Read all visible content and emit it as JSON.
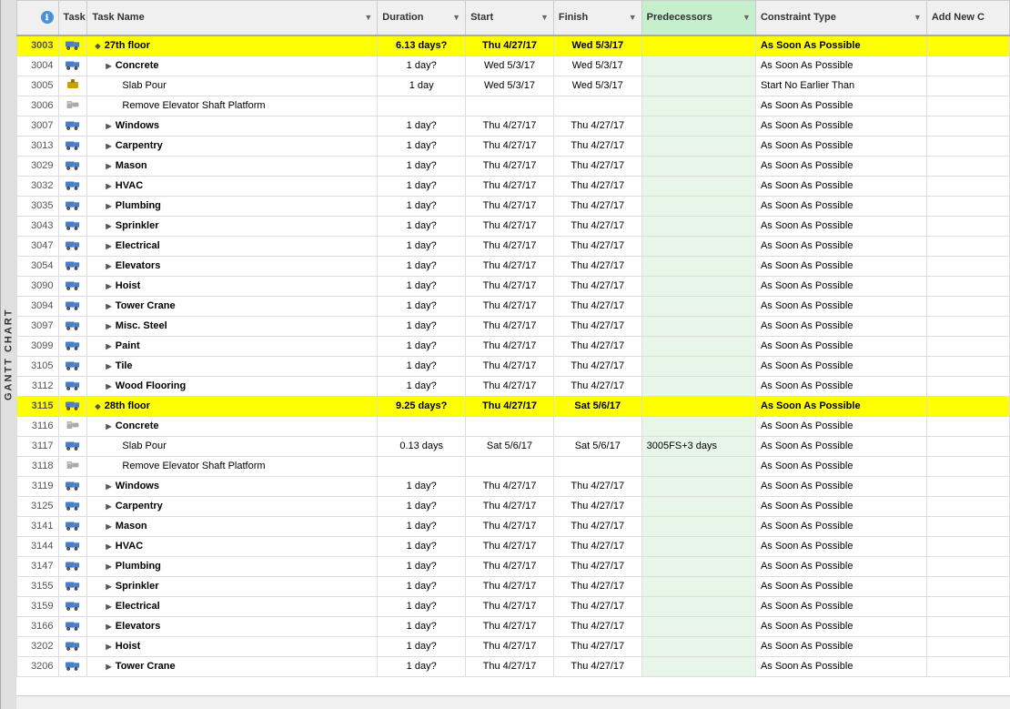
{
  "gantt_label": "GANTT CHART",
  "columns": {
    "row_num": "",
    "info": "ℹ",
    "task_mode": "Task Mode",
    "task_name": "Task Name",
    "duration": "Duration",
    "start": "Start",
    "finish": "Finish",
    "predecessors": "Predecessors",
    "constraint_type": "Constraint Type",
    "add_new": "Add New C"
  },
  "rows": [
    {
      "id": "3003",
      "mode_icon": "🚛",
      "name": "27th floor",
      "indent": 1,
      "bold": true,
      "diamond": true,
      "duration": "6.13 days?",
      "start": "Thu 4/27/17",
      "finish": "Wed 5/3/17",
      "predecessors": "",
      "constraint": "As Soon As Possible",
      "summary": true
    },
    {
      "id": "3004",
      "mode_icon": "🚛",
      "name": "Concrete",
      "indent": 2,
      "bold": true,
      "diamond": false,
      "duration": "1 day?",
      "start": "Wed 5/3/17",
      "finish": "Wed 5/3/17",
      "predecessors": "",
      "constraint": "As Soon As Possible",
      "summary": false
    },
    {
      "id": "3005",
      "mode_icon": "📌",
      "name": "Slab Pour",
      "indent": 3,
      "bold": false,
      "diamond": false,
      "duration": "1 day",
      "start": "Wed 5/3/17",
      "finish": "Wed 5/3/17",
      "predecessors": "",
      "constraint": "Start No Earlier Than",
      "summary": false
    },
    {
      "id": "3006",
      "mode_icon": "🔧",
      "name": "Remove Elevator Shaft Platform",
      "indent": 3,
      "bold": false,
      "diamond": false,
      "duration": "",
      "start": "",
      "finish": "",
      "predecessors": "",
      "constraint": "As Soon As Possible",
      "summary": false
    },
    {
      "id": "3007",
      "mode_icon": "🚛",
      "name": "Windows",
      "indent": 2,
      "bold": true,
      "diamond": true,
      "duration": "1 day?",
      "start": "Thu 4/27/17",
      "finish": "Thu 4/27/17",
      "predecessors": "",
      "constraint": "As Soon As Possible",
      "summary": false
    },
    {
      "id": "3013",
      "mode_icon": "🚛",
      "name": "Carpentry",
      "indent": 2,
      "bold": true,
      "diamond": true,
      "duration": "1 day?",
      "start": "Thu 4/27/17",
      "finish": "Thu 4/27/17",
      "predecessors": "",
      "constraint": "As Soon As Possible",
      "summary": false
    },
    {
      "id": "3029",
      "mode_icon": "🚛",
      "name": "Mason",
      "indent": 2,
      "bold": true,
      "diamond": true,
      "duration": "1 day?",
      "start": "Thu 4/27/17",
      "finish": "Thu 4/27/17",
      "predecessors": "",
      "constraint": "As Soon As Possible",
      "summary": false
    },
    {
      "id": "3032",
      "mode_icon": "🚛",
      "name": "HVAC",
      "indent": 2,
      "bold": true,
      "diamond": true,
      "duration": "1 day?",
      "start": "Thu 4/27/17",
      "finish": "Thu 4/27/17",
      "predecessors": "",
      "constraint": "As Soon As Possible",
      "summary": false
    },
    {
      "id": "3035",
      "mode_icon": "🚛",
      "name": "Plumbing",
      "indent": 2,
      "bold": true,
      "diamond": true,
      "duration": "1 day?",
      "start": "Thu 4/27/17",
      "finish": "Thu 4/27/17",
      "predecessors": "",
      "constraint": "As Soon As Possible",
      "summary": false
    },
    {
      "id": "3043",
      "mode_icon": "🚛",
      "name": "Sprinkler",
      "indent": 2,
      "bold": true,
      "diamond": true,
      "duration": "1 day?",
      "start": "Thu 4/27/17",
      "finish": "Thu 4/27/17",
      "predecessors": "",
      "constraint": "As Soon As Possible",
      "summary": false
    },
    {
      "id": "3047",
      "mode_icon": "🚛",
      "name": "Electrical",
      "indent": 2,
      "bold": true,
      "diamond": true,
      "duration": "1 day?",
      "start": "Thu 4/27/17",
      "finish": "Thu 4/27/17",
      "predecessors": "",
      "constraint": "As Soon As Possible",
      "summary": false
    },
    {
      "id": "3054",
      "mode_icon": "🚛",
      "name": "Elevators",
      "indent": 2,
      "bold": true,
      "diamond": true,
      "duration": "1 day?",
      "start": "Thu 4/27/17",
      "finish": "Thu 4/27/17",
      "predecessors": "",
      "constraint": "As Soon As Possible",
      "summary": false
    },
    {
      "id": "3090",
      "mode_icon": "🚛",
      "name": "Hoist",
      "indent": 2,
      "bold": true,
      "diamond": true,
      "duration": "1 day?",
      "start": "Thu 4/27/17",
      "finish": "Thu 4/27/17",
      "predecessors": "",
      "constraint": "As Soon As Possible",
      "summary": false
    },
    {
      "id": "3094",
      "mode_icon": "🚛",
      "name": "Tower Crane",
      "indent": 2,
      "bold": true,
      "diamond": true,
      "duration": "1 day?",
      "start": "Thu 4/27/17",
      "finish": "Thu 4/27/17",
      "predecessors": "",
      "constraint": "As Soon As Possible",
      "summary": false
    },
    {
      "id": "3097",
      "mode_icon": "🚛",
      "name": "Misc. Steel",
      "indent": 2,
      "bold": true,
      "diamond": true,
      "duration": "1 day?",
      "start": "Thu 4/27/17",
      "finish": "Thu 4/27/17",
      "predecessors": "",
      "constraint": "As Soon As Possible",
      "summary": false
    },
    {
      "id": "3099",
      "mode_icon": "🚛",
      "name": "Paint",
      "indent": 2,
      "bold": true,
      "diamond": true,
      "duration": "1 day?",
      "start": "Thu 4/27/17",
      "finish": "Thu 4/27/17",
      "predecessors": "",
      "constraint": "As Soon As Possible",
      "summary": false
    },
    {
      "id": "3105",
      "mode_icon": "🚛",
      "name": "Tile",
      "indent": 2,
      "bold": true,
      "diamond": true,
      "duration": "1 day?",
      "start": "Thu 4/27/17",
      "finish": "Thu 4/27/17",
      "predecessors": "",
      "constraint": "As Soon As Possible",
      "summary": false
    },
    {
      "id": "3112",
      "mode_icon": "🚛",
      "name": "Wood Flooring",
      "indent": 2,
      "bold": true,
      "diamond": true,
      "duration": "1 day?",
      "start": "Thu 4/27/17",
      "finish": "Thu 4/27/17",
      "predecessors": "",
      "constraint": "As Soon As Possible",
      "summary": false
    },
    {
      "id": "3115",
      "mode_icon": "🚛",
      "name": "28th floor",
      "indent": 1,
      "bold": true,
      "diamond": true,
      "duration": "9.25 days?",
      "start": "Thu 4/27/17",
      "finish": "Sat 5/6/17",
      "predecessors": "",
      "constraint": "As Soon As Possible",
      "summary": true
    },
    {
      "id": "3116",
      "mode_icon": "🔧",
      "name": "Concrete",
      "indent": 2,
      "bold": true,
      "diamond": false,
      "duration": "",
      "start": "",
      "finish": "",
      "predecessors": "",
      "constraint": "As Soon As Possible",
      "summary": false
    },
    {
      "id": "3117",
      "mode_icon": "🚛",
      "name": "Slab Pour",
      "indent": 3,
      "bold": false,
      "diamond": false,
      "duration": "0.13 days",
      "start": "Sat 5/6/17",
      "finish": "Sat 5/6/17",
      "predecessors": "3005FS+3 days",
      "constraint": "As Soon As Possible",
      "summary": false
    },
    {
      "id": "3118",
      "mode_icon": "🔧",
      "name": "Remove Elevator Shaft Platform",
      "indent": 3,
      "bold": false,
      "diamond": false,
      "duration": "",
      "start": "",
      "finish": "",
      "predecessors": "",
      "constraint": "As Soon As Possible",
      "summary": false
    },
    {
      "id": "3119",
      "mode_icon": "🚛",
      "name": "Windows",
      "indent": 2,
      "bold": true,
      "diamond": true,
      "duration": "1 day?",
      "start": "Thu 4/27/17",
      "finish": "Thu 4/27/17",
      "predecessors": "",
      "constraint": "As Soon As Possible",
      "summary": false
    },
    {
      "id": "3125",
      "mode_icon": "🚛",
      "name": "Carpentry",
      "indent": 2,
      "bold": true,
      "diamond": true,
      "duration": "1 day?",
      "start": "Thu 4/27/17",
      "finish": "Thu 4/27/17",
      "predecessors": "",
      "constraint": "As Soon As Possible",
      "summary": false
    },
    {
      "id": "3141",
      "mode_icon": "🚛",
      "name": "Mason",
      "indent": 2,
      "bold": true,
      "diamond": true,
      "duration": "1 day?",
      "start": "Thu 4/27/17",
      "finish": "Thu 4/27/17",
      "predecessors": "",
      "constraint": "As Soon As Possible",
      "summary": false
    },
    {
      "id": "3144",
      "mode_icon": "🚛",
      "name": "HVAC",
      "indent": 2,
      "bold": true,
      "diamond": true,
      "duration": "1 day?",
      "start": "Thu 4/27/17",
      "finish": "Thu 4/27/17",
      "predecessors": "",
      "constraint": "As Soon As Possible",
      "summary": false
    },
    {
      "id": "3147",
      "mode_icon": "🚛",
      "name": "Plumbing",
      "indent": 2,
      "bold": true,
      "diamond": true,
      "duration": "1 day?",
      "start": "Thu 4/27/17",
      "finish": "Thu 4/27/17",
      "predecessors": "",
      "constraint": "As Soon As Possible",
      "summary": false
    },
    {
      "id": "3155",
      "mode_icon": "🚛",
      "name": "Sprinkler",
      "indent": 2,
      "bold": true,
      "diamond": true,
      "duration": "1 day?",
      "start": "Thu 4/27/17",
      "finish": "Thu 4/27/17",
      "predecessors": "",
      "constraint": "As Soon As Possible",
      "summary": false
    },
    {
      "id": "3159",
      "mode_icon": "🚛",
      "name": "Electrical",
      "indent": 2,
      "bold": true,
      "diamond": true,
      "duration": "1 day?",
      "start": "Thu 4/27/17",
      "finish": "Thu 4/27/17",
      "predecessors": "",
      "constraint": "As Soon As Possible",
      "summary": false
    },
    {
      "id": "3166",
      "mode_icon": "🚛",
      "name": "Elevators",
      "indent": 2,
      "bold": true,
      "diamond": true,
      "duration": "1 day?",
      "start": "Thu 4/27/17",
      "finish": "Thu 4/27/17",
      "predecessors": "",
      "constraint": "As Soon As Possible",
      "summary": false
    },
    {
      "id": "3202",
      "mode_icon": "🚛",
      "name": "Hoist",
      "indent": 2,
      "bold": true,
      "diamond": true,
      "duration": "1 day?",
      "start": "Thu 4/27/17",
      "finish": "Thu 4/27/17",
      "predecessors": "",
      "constraint": "As Soon As Possible",
      "summary": false
    },
    {
      "id": "3206",
      "mode_icon": "🚛",
      "name": "Tower Crane",
      "indent": 2,
      "bold": true,
      "diamond": true,
      "duration": "1 day?",
      "start": "Thu 4/27/17",
      "finish": "Thu 4/27/17",
      "predecessors": "",
      "constraint": "As Soon As Possible",
      "summary": false
    }
  ]
}
